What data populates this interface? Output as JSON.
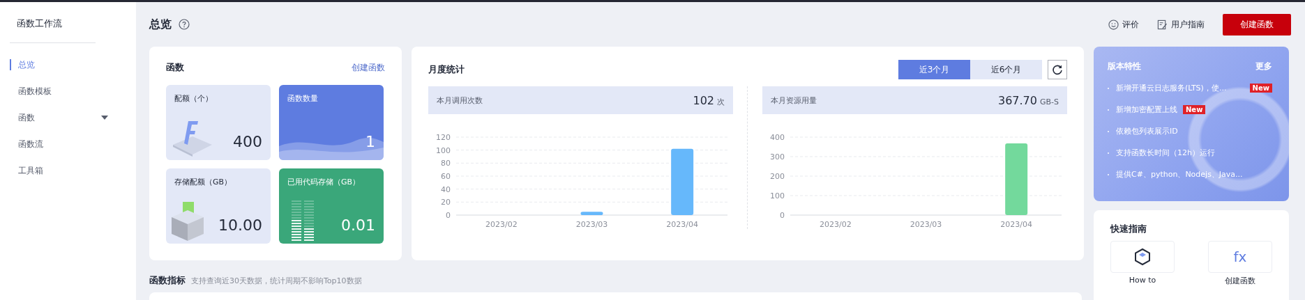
{
  "sidebar": {
    "title": "函数工作流",
    "items": [
      {
        "label": "总览",
        "selected": true
      },
      {
        "label": "函数模板",
        "selected": false
      },
      {
        "label": "函数",
        "selected": false,
        "expandable": true
      },
      {
        "label": "函数流",
        "selected": false
      },
      {
        "label": "工具箱",
        "selected": false
      }
    ]
  },
  "header": {
    "title": "总览",
    "actions": [
      "评价",
      "用户指南"
    ],
    "primary_button": "创建函数"
  },
  "functions_card": {
    "title": "函数",
    "link": "创建函数",
    "tiles": [
      {
        "label": "配额（个）",
        "value": "400",
        "kind": "quota"
      },
      {
        "label": "函数数量",
        "value": "1",
        "kind": "count"
      },
      {
        "label": "存储配额（GB）",
        "value": "10.00",
        "kind": "storage"
      },
      {
        "label": "已用代码存储（GB）",
        "value": "0.01",
        "kind": "used"
      }
    ]
  },
  "monthly_card": {
    "title": "月度统计",
    "periods": [
      {
        "label": "近3个月",
        "selected": true
      },
      {
        "label": "近6个月",
        "selected": false
      }
    ],
    "panels": [
      {
        "label": "本月调用次数",
        "value": "102",
        "unit": "次",
        "chart_data": {
          "type": "bar",
          "categories": [
            "2023/02",
            "2023/03",
            "2023/04"
          ],
          "values": [
            0,
            5,
            102
          ],
          "grid": true,
          "ylim": [
            0,
            120
          ],
          "yticks": [
            0,
            20,
            40,
            60,
            80,
            100,
            120
          ]
        }
      },
      {
        "label": "本月资源用量",
        "value": "367.70",
        "unit": "GB-S",
        "chart_data": {
          "type": "bar",
          "categories": [
            "2023/02",
            "2023/03",
            "2023/04"
          ],
          "values": [
            0,
            0,
            368
          ],
          "grid": true,
          "ylim": [
            0,
            400
          ],
          "yticks": [
            0,
            100,
            200,
            300,
            400
          ]
        }
      }
    ]
  },
  "features_card": {
    "title": "版本特性",
    "more": "更多",
    "items": [
      {
        "text": "新增开通云日志服务(LTS)，使...",
        "badge": "New"
      },
      {
        "text": "新增加密配置上线",
        "badge": "New"
      },
      {
        "text": "依赖包列表展示ID"
      },
      {
        "text": "支持函数长时间（12h）运行"
      },
      {
        "text": "提供C#、python、Nodejs、Java..."
      }
    ]
  },
  "quick_guide": {
    "title": "快速指南",
    "items": [
      {
        "label": "How to",
        "kind": "cube"
      },
      {
        "label": "创建函数",
        "kind": "fx",
        "icon_text": "fx"
      }
    ]
  },
  "metrics": {
    "title": "函数指标",
    "hint": "支持查询近30天数据，统计周期不影响Top10数据"
  }
}
